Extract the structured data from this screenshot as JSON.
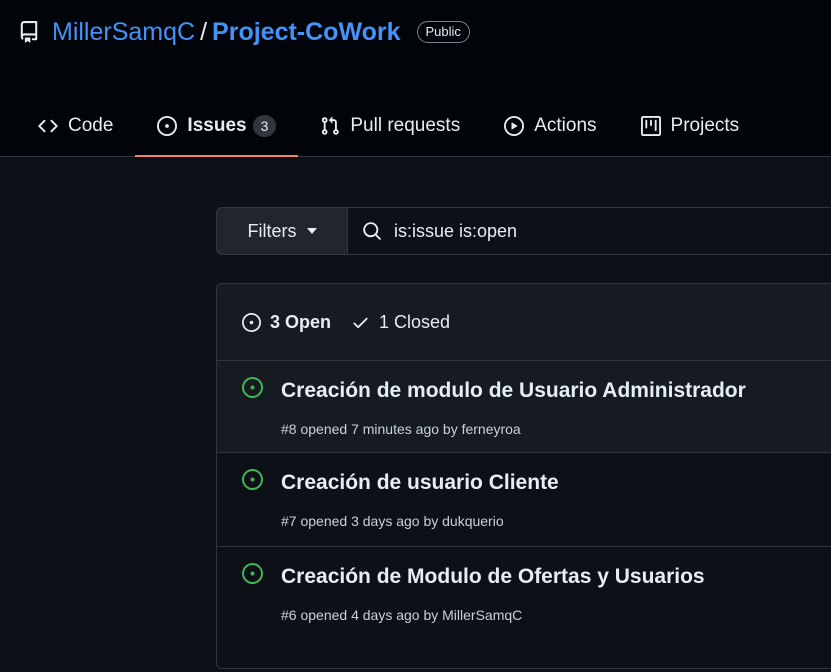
{
  "repo": {
    "owner": "MillerSamqC",
    "separator": "/",
    "name": "Project-CoWork",
    "visibility": "Public"
  },
  "tabs": [
    {
      "label": "Code",
      "icon": "code-icon",
      "selected": false
    },
    {
      "label": "Issues",
      "icon": "issue-opened-icon",
      "counter": "3",
      "selected": true
    },
    {
      "label": "Pull requests",
      "icon": "git-pull-request-icon",
      "selected": false
    },
    {
      "label": "Actions",
      "icon": "play-icon",
      "selected": false
    },
    {
      "label": "Projects",
      "icon": "table-icon",
      "selected": false
    }
  ],
  "filters": {
    "button_label": "Filters",
    "search_value": "is:issue is:open"
  },
  "states": {
    "open_label": "3 Open",
    "closed_label": "1 Closed"
  },
  "issues": [
    {
      "title": "Creación de modulo de Usuario Administrador",
      "meta": "#8 opened 7 minutes ago by ferneyroa"
    },
    {
      "title": "Creación de usuario Cliente",
      "meta": "#7 opened 3 days ago by dukquerio"
    },
    {
      "title": "Creación de Modulo de Ofertas y Usuarios",
      "meta": "#6 opened 4 days ago by MillerSamqC"
    }
  ],
  "colors": {
    "background": "#0d1117",
    "header_background": "#010409",
    "link": "#4493f8",
    "open_green": "#3fb950",
    "selected_underline": "#f78166",
    "border": "#30363d"
  }
}
